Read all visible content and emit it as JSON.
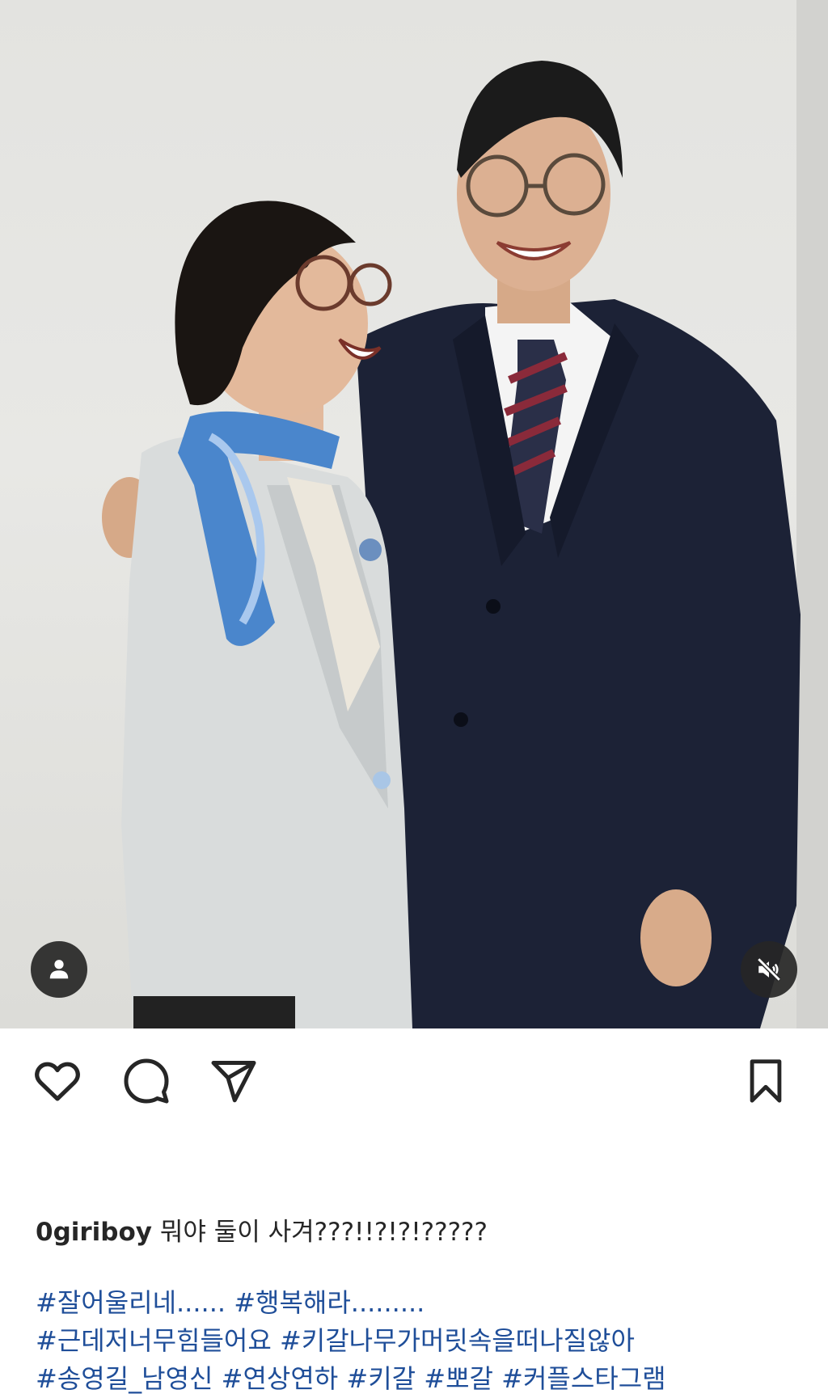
{
  "post": {
    "username": "0giriboy",
    "caption": "뭐야 둘이 사겨???!!?!?!?????",
    "hashtag_lines": [
      [
        "#잘어울리네......",
        "#행복해라........."
      ],
      [
        "#근데저너무힘들어요",
        "#키갈나무가머릿속을떠나질않아"
      ],
      [
        "#송영길_남영신",
        "#연상연하",
        "#키갈",
        "#뽀갈",
        "#커플스타그램"
      ]
    ]
  },
  "icons": {
    "tag_people": "person-icon",
    "mute": "volume-muted-icon",
    "like": "heart-icon",
    "comment": "comment-icon",
    "share": "send-icon",
    "save": "bookmark-icon"
  },
  "colors": {
    "hashtag": "#1f4e99",
    "overlay_button": "#262626",
    "text": "#262626"
  }
}
